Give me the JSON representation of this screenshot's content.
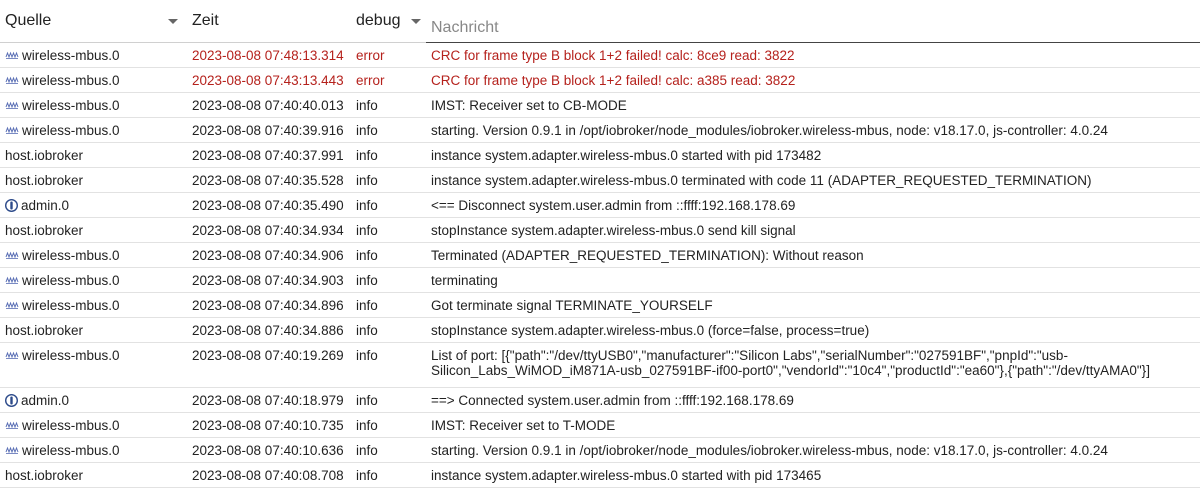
{
  "header": {
    "source": "Quelle",
    "time": "Zeit",
    "level": "debug",
    "message_placeholder": "Nachricht"
  },
  "colors": {
    "error": "#b5211c",
    "mbus_icon": "#5a6fb5",
    "admin_icon": "#2c4a8a"
  },
  "rows": [
    {
      "source": "wireless-mbus.0",
      "icon": "wireless-mbus-icon",
      "time": "2023-08-08 07:48:13.314",
      "level": "error",
      "message": "CRC for frame type B block 1+2 failed! calc: 8ce9 read: 3822"
    },
    {
      "source": "wireless-mbus.0",
      "icon": "wireless-mbus-icon",
      "time": "2023-08-08 07:43:13.443",
      "level": "error",
      "message": "CRC for frame type B block 1+2 failed! calc: a385 read: 3822"
    },
    {
      "source": "wireless-mbus.0",
      "icon": "wireless-mbus-icon",
      "time": "2023-08-08 07:40:40.013",
      "level": "info",
      "message": "IMST: Receiver set to CB-MODE"
    },
    {
      "source": "wireless-mbus.0",
      "icon": "wireless-mbus-icon",
      "time": "2023-08-08 07:40:39.916",
      "level": "info",
      "message": "starting. Version 0.9.1 in /opt/iobroker/node_modules/iobroker.wireless-mbus, node: v18.17.0, js-controller: 4.0.24"
    },
    {
      "source": "host.iobroker",
      "icon": "",
      "time": "2023-08-08 07:40:37.991",
      "level": "info",
      "message": "instance system.adapter.wireless-mbus.0 started with pid 173482"
    },
    {
      "source": "host.iobroker",
      "icon": "",
      "time": "2023-08-08 07:40:35.528",
      "level": "info",
      "message": "instance system.adapter.wireless-mbus.0 terminated with code 11 (ADAPTER_REQUESTED_TERMINATION)"
    },
    {
      "source": "admin.0",
      "icon": "admin-icon",
      "time": "2023-08-08 07:40:35.490",
      "level": "info",
      "message": "<== Disconnect system.user.admin from ::ffff:192.168.178.69"
    },
    {
      "source": "host.iobroker",
      "icon": "",
      "time": "2023-08-08 07:40:34.934",
      "level": "info",
      "message": "stopInstance system.adapter.wireless-mbus.0 send kill signal"
    },
    {
      "source": "wireless-mbus.0",
      "icon": "wireless-mbus-icon",
      "time": "2023-08-08 07:40:34.906",
      "level": "info",
      "message": "Terminated (ADAPTER_REQUESTED_TERMINATION): Without reason"
    },
    {
      "source": "wireless-mbus.0",
      "icon": "wireless-mbus-icon",
      "time": "2023-08-08 07:40:34.903",
      "level": "info",
      "message": "terminating"
    },
    {
      "source": "wireless-mbus.0",
      "icon": "wireless-mbus-icon",
      "time": "2023-08-08 07:40:34.896",
      "level": "info",
      "message": "Got terminate signal TERMINATE_YOURSELF"
    },
    {
      "source": "host.iobroker",
      "icon": "",
      "time": "2023-08-08 07:40:34.886",
      "level": "info",
      "message": "stopInstance system.adapter.wireless-mbus.0 (force=false, process=true)"
    },
    {
      "source": "wireless-mbus.0",
      "icon": "wireless-mbus-icon",
      "time": "2023-08-08 07:40:19.269",
      "level": "info",
      "message": "List of port: [{\"path\":\"/dev/ttyUSB0\",\"manufacturer\":\"Silicon Labs\",\"serialNumber\":\"027591BF\",\"pnpId\":\"usb-Silicon_Labs_WiMOD_iM871A-usb_027591BF-if00-port0\",\"vendorId\":\"10c4\",\"productId\":\"ea60\"},{\"path\":\"/dev/ttyAMA0\"}]"
    },
    {
      "source": "admin.0",
      "icon": "admin-icon",
      "time": "2023-08-08 07:40:18.979",
      "level": "info",
      "message": "==> Connected system.user.admin from ::ffff:192.168.178.69"
    },
    {
      "source": "wireless-mbus.0",
      "icon": "wireless-mbus-icon",
      "time": "2023-08-08 07:40:10.735",
      "level": "info",
      "message": "IMST: Receiver set to T-MODE"
    },
    {
      "source": "wireless-mbus.0",
      "icon": "wireless-mbus-icon",
      "time": "2023-08-08 07:40:10.636",
      "level": "info",
      "message": "starting. Version 0.9.1 in /opt/iobroker/node_modules/iobroker.wireless-mbus, node: v18.17.0, js-controller: 4.0.24"
    },
    {
      "source": "host.iobroker",
      "icon": "",
      "time": "2023-08-08 07:40:08.708",
      "level": "info",
      "message": "instance system.adapter.wireless-mbus.0 started with pid 173465"
    }
  ]
}
